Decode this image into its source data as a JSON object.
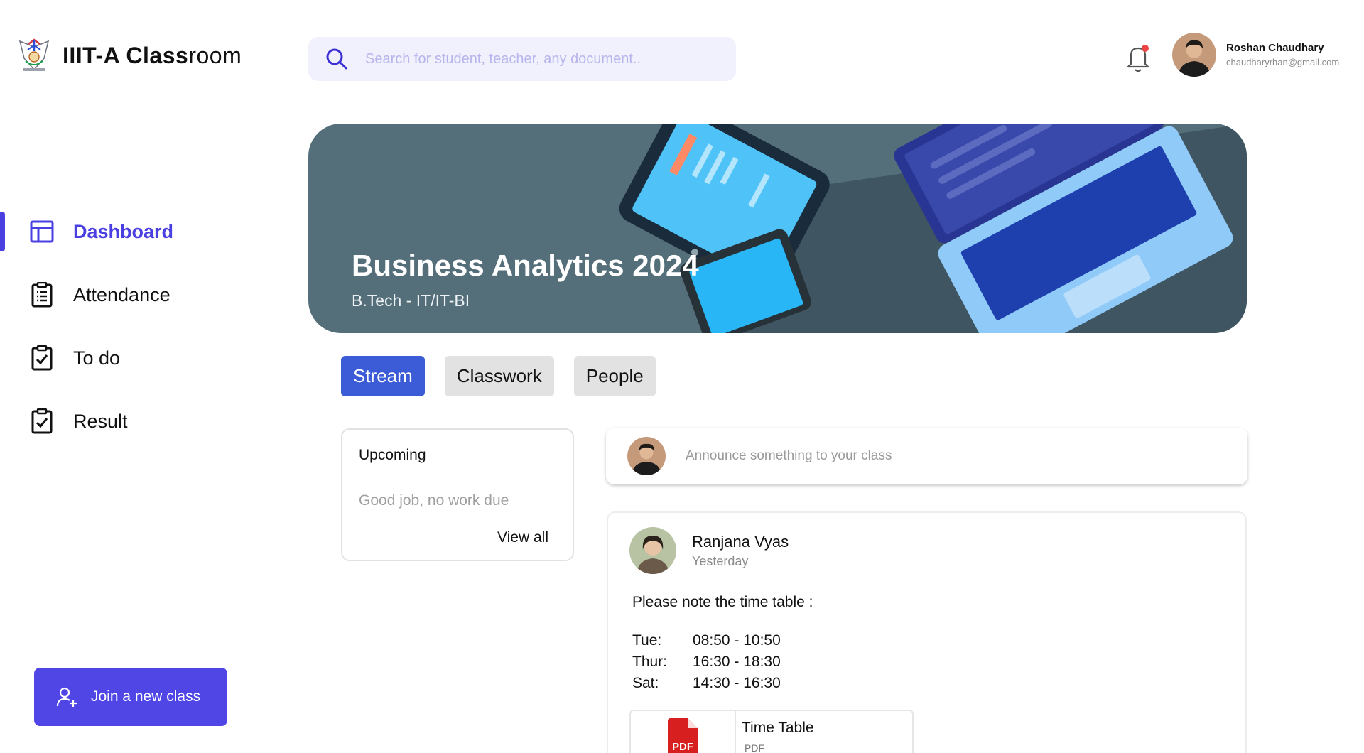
{
  "app": {
    "brand_bold": "IIIT-A Class",
    "brand_light": "room"
  },
  "sidebar": {
    "items": [
      {
        "label": "Dashboard",
        "icon": "layout-icon",
        "active": true
      },
      {
        "label": "Attendance",
        "icon": "clipboard-list-icon",
        "active": false
      },
      {
        "label": "To do",
        "icon": "clipboard-check-icon",
        "active": false
      },
      {
        "label": "Result",
        "icon": "clipboard-check-icon",
        "active": false
      }
    ],
    "join_label": "Join a new class"
  },
  "search": {
    "placeholder": "Search for student, teacher, any document.."
  },
  "user": {
    "name": "Roshan Chaudhary",
    "email": "chaudharyrhan@gmail.com"
  },
  "banner": {
    "title": "Business Analytics 2024",
    "subtitle": "B.Tech - IT/IT-BI"
  },
  "tabs": [
    {
      "label": "Stream",
      "active": true
    },
    {
      "label": "Classwork",
      "active": false
    },
    {
      "label": "People",
      "active": false
    }
  ],
  "upcoming": {
    "title": "Upcoming",
    "empty_text": "Good job, no work due",
    "view_all": "View all"
  },
  "announce": {
    "placeholder": "Announce something to your class"
  },
  "post": {
    "author": "Ranjana Vyas",
    "time": "Yesterday",
    "text": "Please note the time table :",
    "schedule": [
      {
        "day": "Tue:",
        "time": "08:50 - 10:50"
      },
      {
        "day": "Thur:",
        "time": "16:30 - 18:30"
      },
      {
        "day": "Sat:",
        "time": "14:30 - 16:30"
      }
    ],
    "attachment": {
      "name": "Time Table",
      "type": "PDF",
      "badge": "PDF"
    }
  },
  "colors": {
    "accent": "#4a3fe0",
    "join_button": "#4f46e5",
    "tab_active": "#3c5bd6",
    "banner_bg": "#546e7a",
    "notification": "#ef4444"
  }
}
